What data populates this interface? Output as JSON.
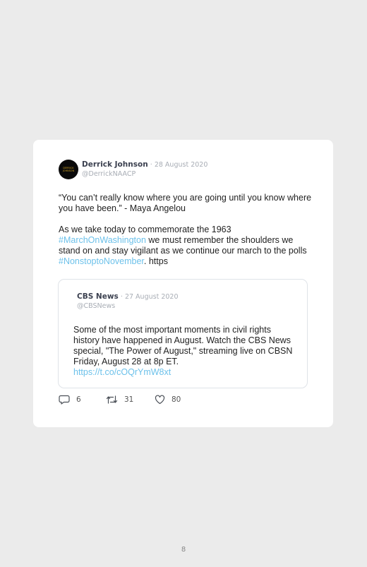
{
  "tweet": {
    "author_name": "Derrick Johnson",
    "separator": "·",
    "date": "28 August 2020",
    "handle": "@DerrickNAACP",
    "avatar_text": "DERRICK JOHNSON",
    "paragraph1": "“You can’t really know where you are going until you know where you have been.” - Maya Angelou",
    "p2_text1": "As we take today to commemorate the 1963 ",
    "p2_tag1": "#MarchOnWashington",
    "p2_text2": " we must remember the shoulders we stand on and stay vigilant as we continue our march to the polls ",
    "p2_tag2": "#NonstoptoNovember",
    "p2_text3": ". https"
  },
  "quoted": {
    "author_name": "CBS News",
    "separator": "·",
    "date": "27 August 2020",
    "handle": "@CBSNews",
    "text": "Some of the most important moments in civil rights history have happened in August. Watch the CBS News special, \"The Power of August,\" streaming live on CBSN Friday, August 28 at 8p ET.",
    "link": "https://t.co/cOQrYmW8xt"
  },
  "actions": {
    "replies": "6",
    "retweets": "31",
    "likes": "80"
  },
  "page_number": "8",
  "icons": {
    "reply": "reply-icon",
    "retweet": "retweet-icon",
    "like": "heart-icon"
  },
  "colors": {
    "hashtag": "#6cc1ea",
    "background": "#ebebeb",
    "card": "#ffffff"
  }
}
